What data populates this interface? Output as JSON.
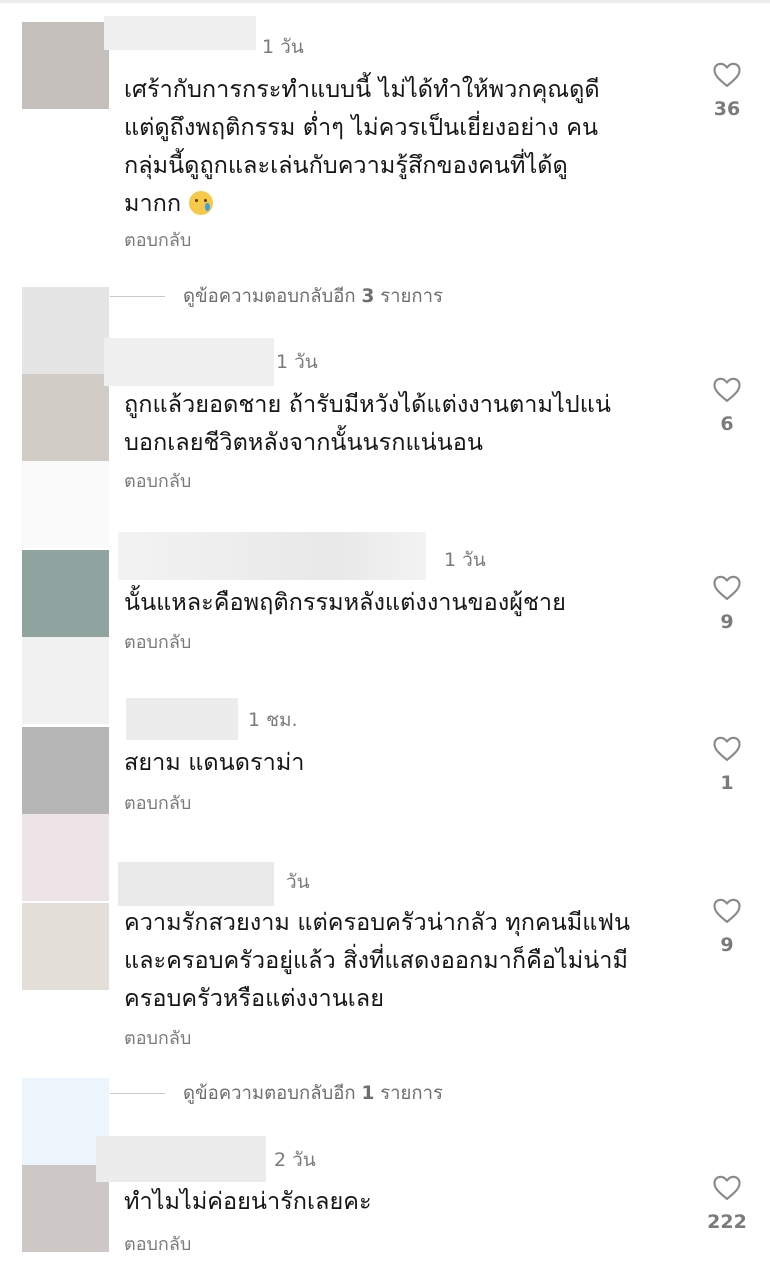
{
  "comments": [
    {
      "time": "1 วัน",
      "text": [
        "เศร้ากับการกระทำแบบนี้ ไม่ได้ทำให้พวกคุณดูดี",
        "แต่ดูถึงพฤติกรรม ต่ำๆ ไม่ควรเป็นเยี่ยงอย่าง คน",
        "กลุ่มนี้ดูถูกและเล่นกับความรู้สึกของคนที่ได้ดู",
        "มากก"
      ],
      "emoji": "sad-tear-emoji",
      "reply": "ตอบกลับ",
      "likes": "36"
    },
    {
      "time": "1 วัน",
      "text": [
        "ถูกแล้วยอดชาย ถ้ารับมีหวังได้แต่งงานตามไปแน่",
        "บอกเลยชีวิตหลังจากนั้นนรกแน่นอน"
      ],
      "reply": "ตอบกลับ",
      "likes": "6"
    },
    {
      "time": "1 วัน",
      "text": [
        "นั้นแหละคือพฤติกรรมหลังแต่งงานของผู้ชาย"
      ],
      "reply": "ตอบกลับ",
      "likes": "9"
    },
    {
      "time": "1 ชม.",
      "text": [
        "สยาม แดนดราม่า"
      ],
      "reply": "ตอบกลับ",
      "likes": "1"
    },
    {
      "time": "วัน",
      "text": [
        "ความรักสวยงาม แต่ครอบครัวน่ากลัว ทุกคนมีแฟน",
        "และครอบครัวอยู่แล้ว สิ่งที่แสดงออกมาก็คือไม่น่ามี",
        "ครอบครัวหรือแต่งงานเลย"
      ],
      "reply": "ตอบกลับ",
      "likes": "9"
    },
    {
      "time": "2 วัน",
      "text": [
        "ทำไมไม่ค่อยน่ารักเลยคะ"
      ],
      "reply": "ตอบกลับ",
      "likes": "222"
    }
  ],
  "view_replies": [
    {
      "prefix": "ดูข้อความตอบกลับอีก ",
      "count": "3",
      "suffix": " รายการ"
    },
    {
      "prefix": "ดูข้อความตอบกลับอีก ",
      "count": "1",
      "suffix": " รายการ"
    }
  ],
  "colors": {
    "text": "#161616",
    "muted": "#7b7b7b",
    "heart": "#8a8a8a"
  }
}
